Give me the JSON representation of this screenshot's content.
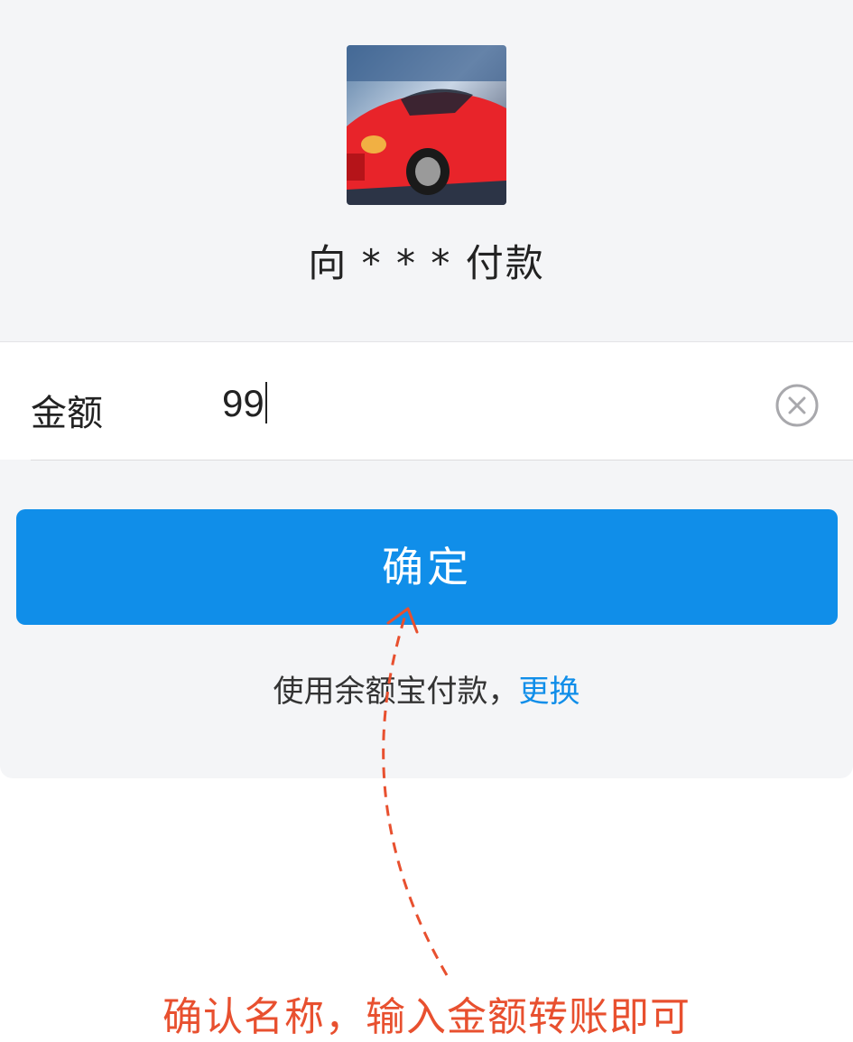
{
  "payee": {
    "prefix": "向",
    "name_masked": "* * *",
    "suffix": "付款"
  },
  "amount": {
    "label": "金额",
    "value": "99"
  },
  "icons": {
    "clear": "clear-circle-icon",
    "avatar": "car-avatar-image"
  },
  "confirm_button": {
    "label": "确定"
  },
  "payment_method": {
    "text": "使用余额宝付款，",
    "change_link": "更换"
  },
  "annotation": {
    "text": "确认名称，输入金额转账即可"
  },
  "colors": {
    "accent": "#108ee9",
    "annotation": "#e8502f",
    "background": "#f4f5f7"
  }
}
